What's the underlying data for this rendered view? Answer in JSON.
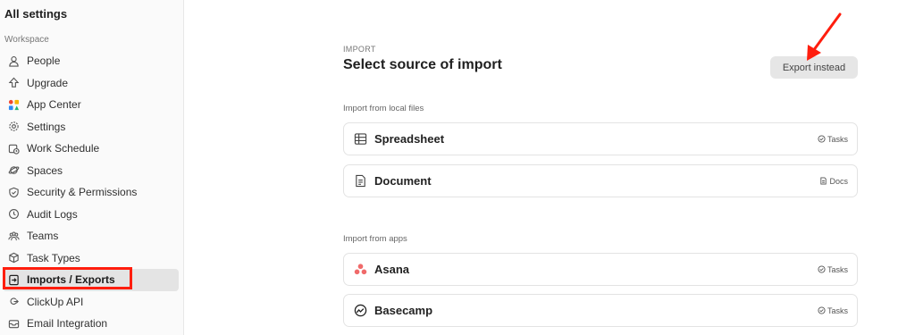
{
  "sidebar": {
    "title": "All settings",
    "section": "Workspace",
    "items": [
      {
        "label": "People",
        "icon": "person-icon"
      },
      {
        "label": "Upgrade",
        "icon": "upgrade-icon"
      },
      {
        "label": "App Center",
        "icon": "app-center-icon"
      },
      {
        "label": "Settings",
        "icon": "gear-icon"
      },
      {
        "label": "Work Schedule",
        "icon": "calendar-clock-icon"
      },
      {
        "label": "Spaces",
        "icon": "planet-icon"
      },
      {
        "label": "Security & Permissions",
        "icon": "shield-icon"
      },
      {
        "label": "Audit Logs",
        "icon": "history-icon"
      },
      {
        "label": "Teams",
        "icon": "team-icon"
      },
      {
        "label": "Task Types",
        "icon": "cube-icon"
      },
      {
        "label": "Imports / Exports",
        "icon": "import-icon",
        "active": true
      },
      {
        "label": "ClickUp API",
        "icon": "api-icon"
      },
      {
        "label": "Email Integration",
        "icon": "mail-icon"
      }
    ]
  },
  "main": {
    "eyebrow": "IMPORT",
    "title": "Select source of import",
    "export_button": "Export instead",
    "local_label": "Import from local files",
    "apps_label": "Import from apps",
    "local_sources": [
      {
        "name": "Spreadsheet",
        "icon": "table-icon",
        "tag": "Tasks",
        "tag_icon": "check-circle-icon"
      },
      {
        "name": "Document",
        "icon": "document-icon",
        "tag": "Docs",
        "tag_icon": "doc-icon"
      }
    ],
    "app_sources": [
      {
        "name": "Asana",
        "icon": "asana-icon",
        "tag": "Tasks",
        "tag_icon": "check-circle-icon"
      },
      {
        "name": "Basecamp",
        "icon": "basecamp-icon",
        "tag": "Tasks",
        "tag_icon": "check-circle-icon"
      }
    ]
  },
  "colors": {
    "annotation_red": "#ff1e0e",
    "asana": "#f06a6a"
  }
}
